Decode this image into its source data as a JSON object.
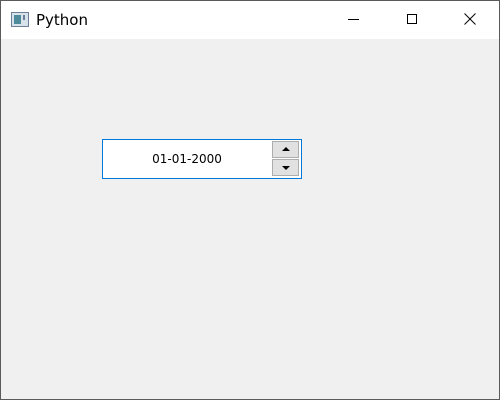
{
  "window": {
    "title": "Python",
    "icon": "python-window-icon"
  },
  "caption_buttons": {
    "minimize_icon": "minimize-icon",
    "maximize_icon": "maximize-icon",
    "close_icon": "close-icon"
  },
  "date_edit": {
    "value": "01-01-2000",
    "up_icon": "arrow-up-icon",
    "down_icon": "arrow-down-icon"
  },
  "colors": {
    "focus_border": "#0078d7",
    "client_background": "#f0f0f0",
    "titlebar_background": "#ffffff"
  }
}
